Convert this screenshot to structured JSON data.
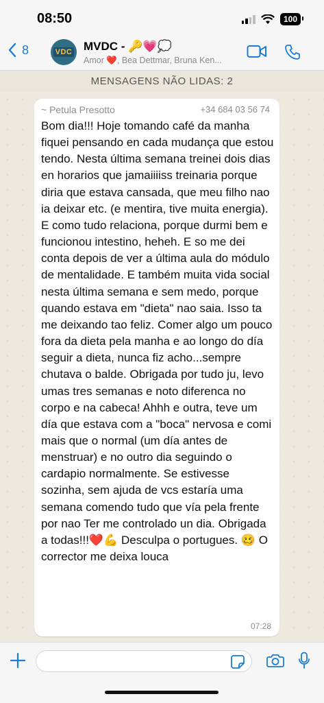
{
  "status_bar": {
    "time": "08:50",
    "battery": "100"
  },
  "header": {
    "back_count": "8",
    "avatar_text": "VDC",
    "title": "MVDC - 🔑💗💭",
    "subtitle": "Amor ❤️, Bea Dettmar, Bruna Ken..."
  },
  "banner": {
    "unread": "MENSAGENS NÃO LIDAS: 2"
  },
  "message": {
    "sender": "~ Petula Presotto",
    "phone": "+34 684 03 56 74",
    "text": "Bom dia!!! Hoje tomando café da manha fiquei pensando en cada mudança que estou tendo. Nesta última  semana treinei dois dias en horarios que jamaiiiiss treinaria porque diria que estava cansada, que meu filho nao ia deixar etc. (e mentira, tive muita energia). E como tudo relaciona, porque durmi bem e funcionou intestino, heheh. E so me dei conta depois de ver a última aula do módulo de mentalidade. E também muita vida social nesta última semana e sem medo, porque  quando estava em \"dieta\" nao saia. Isso ta me deixando tao feliz. Comer algo um pouco fora da dieta pela manha e ao longo do día seguir a dieta, nunca fiz acho...sempre chutava o balde. Obrigada por tudo ju, levo umas tres semanas e noto diferenca no corpo e na cabeca!  Ahhh e outra, teve um día que estava com a \"boca\" nervosa e comi mais que o normal (um día antes de menstruar) e no outro dia seguindo o cardapio normalmente. Se estivesse sozinha, sem ajuda de vcs estaría uma semana comendo tudo que vía pela frente por nao Ter me controlado un dia. Obrigada a todas!!!❤️💪 Desculpa o portugues. 🥴 O corrector me deixa louca",
    "time": "07:28"
  },
  "input": {
    "placeholder": ""
  },
  "icons": [
    "back-chevron-icon",
    "video-call-icon",
    "phone-call-icon",
    "plus-icon",
    "sticker-icon",
    "camera-icon",
    "microphone-icon",
    "wifi-icon",
    "signal-icon",
    "battery-icon"
  ],
  "colors": {
    "accent": "#1b7bd8",
    "chat_bg": "#efe8df",
    "bubble": "#ffffff"
  }
}
